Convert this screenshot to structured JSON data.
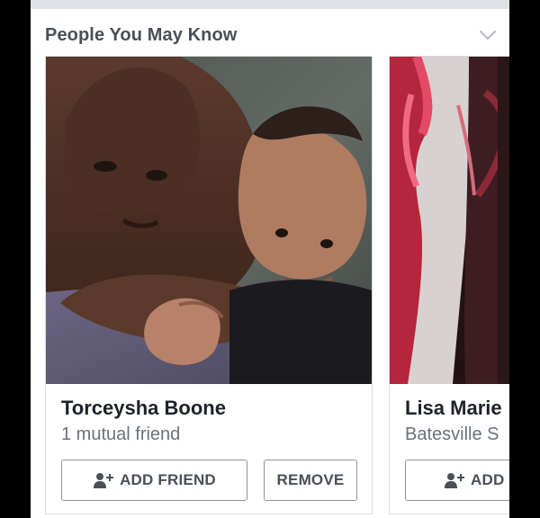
{
  "section": {
    "title": "People You May Know"
  },
  "icons": {
    "collapse": "chevron-down-icon",
    "add_friend": "add-person-icon"
  },
  "colors": {
    "title_text": "#4b4f56",
    "name_text": "#1d2129",
    "subtext": "#6d717a",
    "button_border": "#8d949e",
    "page_background": "#e9ebee"
  },
  "cards": [
    {
      "name": "Torceysha Boone",
      "subtext": "1 mutual friend",
      "add_label": "ADD FRIEND",
      "remove_label": "REMOVE"
    },
    {
      "name": "Lisa Marie",
      "subtext": "Batesville S",
      "add_label": "ADD"
    }
  ]
}
